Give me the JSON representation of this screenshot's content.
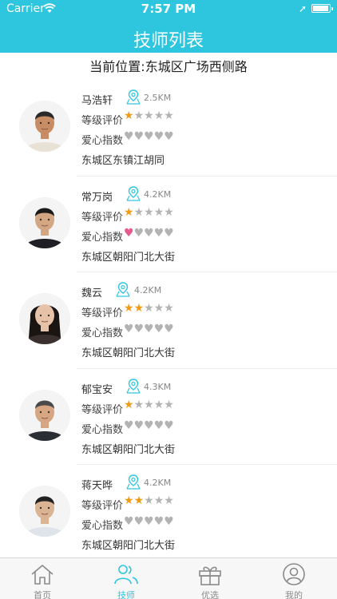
{
  "status_bar": {
    "carrier": "Carrier",
    "time": "7:57 PM"
  },
  "nav": {
    "title": "技师列表"
  },
  "location": {
    "text": "当前位置:东城区广场西侧路"
  },
  "labels": {
    "rating": "等级评价",
    "love": "爱心指数"
  },
  "technicians": [
    {
      "name": "马浩轩",
      "distance": "2.5KM",
      "rating": 1,
      "love": 0,
      "address": "东城区东镇江胡同"
    },
    {
      "name": "常万岗",
      "distance": "4.2KM",
      "rating": 1,
      "love": 1,
      "address": "东城区朝阳门北大街"
    },
    {
      "name": "魏云",
      "distance": "4.2KM",
      "rating": 2,
      "love": 0,
      "address": "东城区朝阳门北大街"
    },
    {
      "name": "郁宝安",
      "distance": "4.3KM",
      "rating": 1,
      "love": 0,
      "address": "东城区朝阳门北大街"
    },
    {
      "name": "蒋天晔",
      "distance": "4.2KM",
      "rating": 2,
      "love": 0,
      "address": "东城区朝阳门北大街"
    }
  ],
  "tabbar": {
    "home": "首页",
    "technician": "技师",
    "selected": "优选",
    "mine": "我的"
  },
  "colors": {
    "accent": "#2ec6de",
    "star": "#f29b12",
    "heart": "#e8598d",
    "inactive": "#b3b3b3",
    "tab_active": "#2ec6de",
    "tab_inactive": "#8a8a8a"
  }
}
